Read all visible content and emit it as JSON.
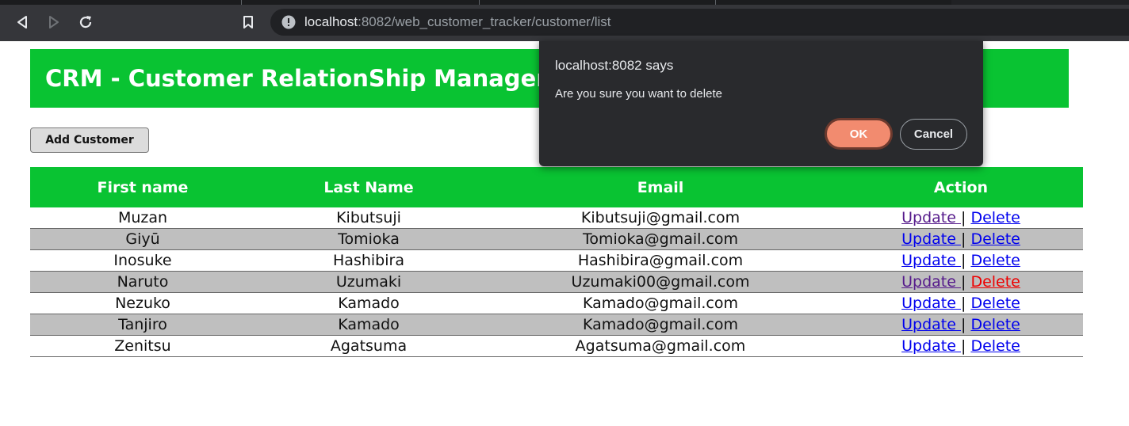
{
  "browser": {
    "url_host": "localhost",
    "url_rest": ":8082/web_customer_tracker/customer/list",
    "icons": {
      "back": "back-icon",
      "forward": "forward-icon",
      "reload": "reload-icon",
      "bookmark": "bookmark-icon",
      "site_info": "info-icon"
    }
  },
  "page": {
    "title": "CRM - Customer RelationShip Manager",
    "add_button": "Add Customer",
    "colors": {
      "accent": "#09c332",
      "stripe": "#bfbfbf"
    }
  },
  "table": {
    "headers": [
      "First name",
      "Last Name",
      "Email",
      "Action"
    ],
    "update_label": "Update ",
    "separator": "|",
    "delete_label": "Delete",
    "rows": [
      {
        "first": "Muzan",
        "last": "Kibutsuji",
        "email": "Kibutsuji@gmail.com"
      },
      {
        "first": "Giyū",
        "last": "Tomioka",
        "email": "Tomioka@gmail.com"
      },
      {
        "first": "Inosuke",
        "last": "Hashibira",
        "email": "Hashibira@gmail.com"
      },
      {
        "first": "Naruto",
        "last": "Uzumaki",
        "email": "Uzumaki00@gmail.com"
      },
      {
        "first": "Nezuko",
        "last": "Kamado",
        "email": "Kamado@gmail.com"
      },
      {
        "first": "Tanjiro",
        "last": "Kamado",
        "email": "Kamado@gmail.com"
      },
      {
        "first": "Zenitsu",
        "last": "Agatsuma",
        "email": "Agatsuma@gmail.com"
      }
    ]
  },
  "dialog": {
    "title": "localhost:8082 says",
    "message": "Are you sure you want to delete",
    "ok": "OK",
    "cancel": "Cancel",
    "colors": {
      "ok_bg": "#f28b6f",
      "bg": "#292a2d"
    }
  }
}
